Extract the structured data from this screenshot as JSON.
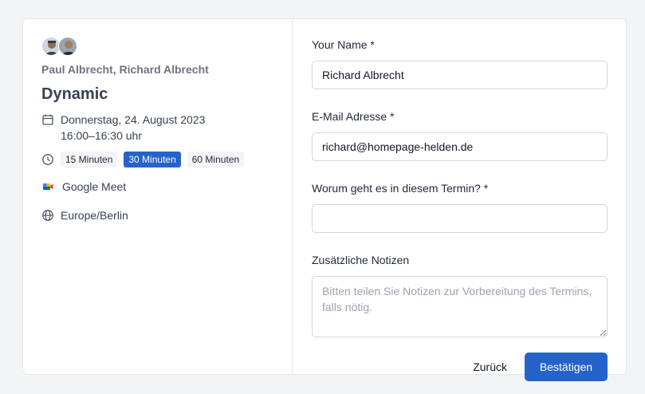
{
  "organizers": {
    "names": "Paul Albrecht, Richard Albrecht",
    "avatars": [
      "person-avatar-paul",
      "person-avatar-richard"
    ]
  },
  "event": {
    "title": "Dynamic",
    "date": "Donnerstag, 24. August 2023",
    "time": "16:00–16:30 uhr",
    "durations": [
      {
        "label": "15 Minuten",
        "selected": false
      },
      {
        "label": "30 Minuten",
        "selected": true
      },
      {
        "label": "60 Minuten",
        "selected": false
      }
    ],
    "location": "Google Meet",
    "timezone": "Europe/Berlin"
  },
  "form": {
    "name_label": "Your Name *",
    "name_value": "Richard Albrecht",
    "email_label": "E-Mail Adresse *",
    "email_value": "richard@homepage-helden.de",
    "topic_label": "Worum geht es in diesem Termin? *",
    "topic_value": "",
    "notes_label": "Zusätzliche Notizen",
    "notes_placeholder": "Bitten teilen Sie Notizen zur Vorbereitung des Termins, falls nötig.",
    "back_label": "Zurück",
    "confirm_label": "Bestätigen"
  },
  "colors": {
    "accent": "#2563c9",
    "chip_bg": "#f3f4f6",
    "border": "#e5e7eb"
  },
  "icons": {
    "date": "calendar-icon",
    "duration": "clock-icon",
    "location": "google-meet-icon",
    "timezone": "globe-icon"
  }
}
